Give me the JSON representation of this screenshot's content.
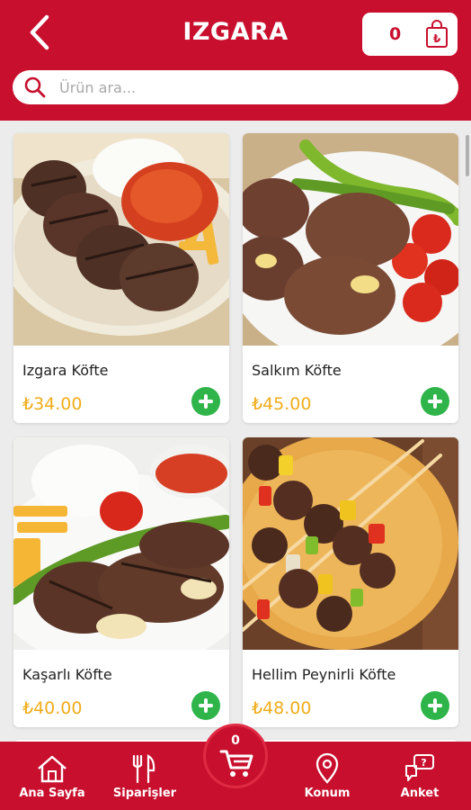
{
  "header": {
    "title": "IZGARA",
    "cart_count": "0",
    "cart_currency_symbol": "₺"
  },
  "search": {
    "placeholder": "Ürün ara..."
  },
  "products": [
    {
      "name": "Izgara Köfte",
      "price": "₺34.00"
    },
    {
      "name": "Salkım Köfte",
      "price": "₺45.00"
    },
    {
      "name": "Kaşarlı Köfte",
      "price": "₺40.00"
    },
    {
      "name": "Hellim Peynirli Köfte",
      "price": "₺48.00"
    }
  ],
  "bottom_nav": {
    "home": "Ana Sayfa",
    "orders": "Siparişler",
    "location": "Konum",
    "survey": "Anket",
    "cart_count": "0"
  },
  "colors": {
    "brand_red": "#c8102e",
    "price_orange": "#f0ad1b",
    "add_green": "#2fb44a"
  }
}
